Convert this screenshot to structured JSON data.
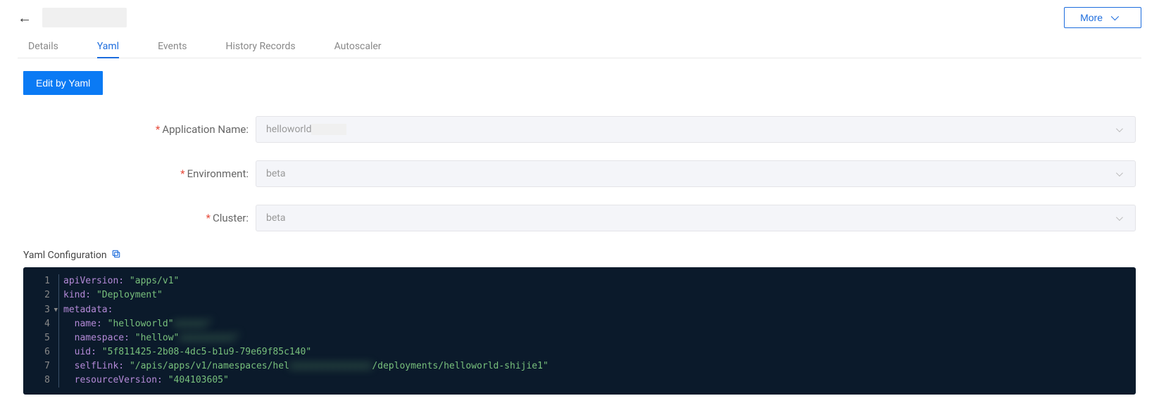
{
  "header": {
    "more_label": "More"
  },
  "tabs": {
    "details": "Details",
    "yaml": "Yaml",
    "events": "Events",
    "history": "History Records",
    "autoscaler": "Autoscaler"
  },
  "buttons": {
    "edit_yaml": "Edit by Yaml"
  },
  "form": {
    "app_name_label": "Application Name:",
    "app_name_value": "helloworld",
    "env_label": "Environment:",
    "env_value": "beta",
    "cluster_label": "Cluster:",
    "cluster_value": "beta"
  },
  "section": {
    "yaml_config": "Yaml Configuration"
  },
  "yaml": {
    "l1k": "apiVersion:",
    "l1v": "\"apps/v1\"",
    "l2k": "kind:",
    "l2v": "\"Deployment\"",
    "l3k": "metadata:",
    "l4k": "name:",
    "l4v": "\"helloworld\"",
    "l5k": "namespace:",
    "l5v": "\"hellow\"",
    "l6k": "uid:",
    "l6v": "\"5f811425-2b08-4dc5-b1u9-79e69f85c140\"",
    "l7k": "selfLink:",
    "l7v1": "\"/apis/apps/v1/namespaces/hel",
    "l7v2": "/deployments/helloworld-shijie1\"",
    "l8k": "resourceVersion:",
    "l8v": "\"404103605\""
  },
  "gutter": {
    "n1": "1",
    "n2": "2",
    "n3": "3",
    "n4": "4",
    "n5": "5",
    "n6": "6",
    "n7": "7",
    "n8": "8"
  }
}
